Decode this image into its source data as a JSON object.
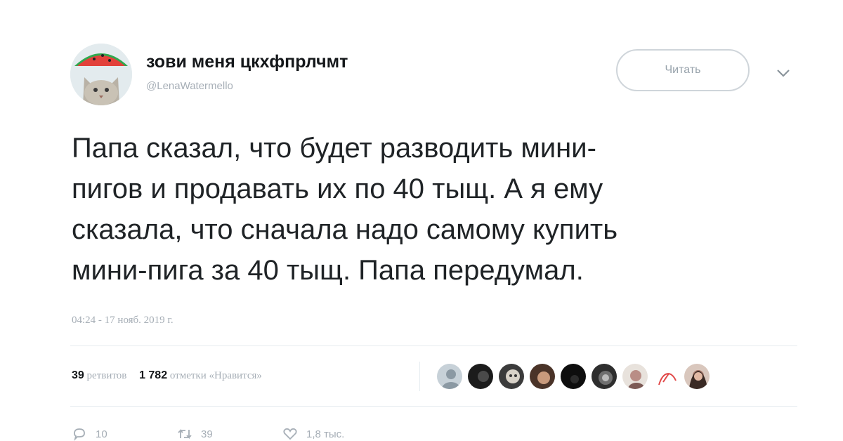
{
  "tweet": {
    "display_name": "зови меня цкхфпрлчмт",
    "handle": "@LenaWatermello",
    "follow_label": "Читать",
    "text_lines": [
      "Папа сказал, что будет разводить мини-",
      "пигов и продавать их по 40 тыщ. А я ему",
      "сказала, что сначала надо самому купить",
      "мини-пига за 40 тыщ. Папа передумал."
    ],
    "timestamp": "04:24 - 17 нояб. 2019 г."
  },
  "stats": {
    "retweets_count": "39",
    "retweets_label": "ретвитов",
    "likes_count": "1 782",
    "likes_label": "отметки «Нравится»"
  },
  "actions": {
    "reply_count": "10",
    "retweet_count": "39",
    "like_count": "1,8 тыс."
  },
  "colors": {
    "text": "#14171a",
    "muted": "#a6aeb6",
    "border": "#e6ecf0"
  }
}
